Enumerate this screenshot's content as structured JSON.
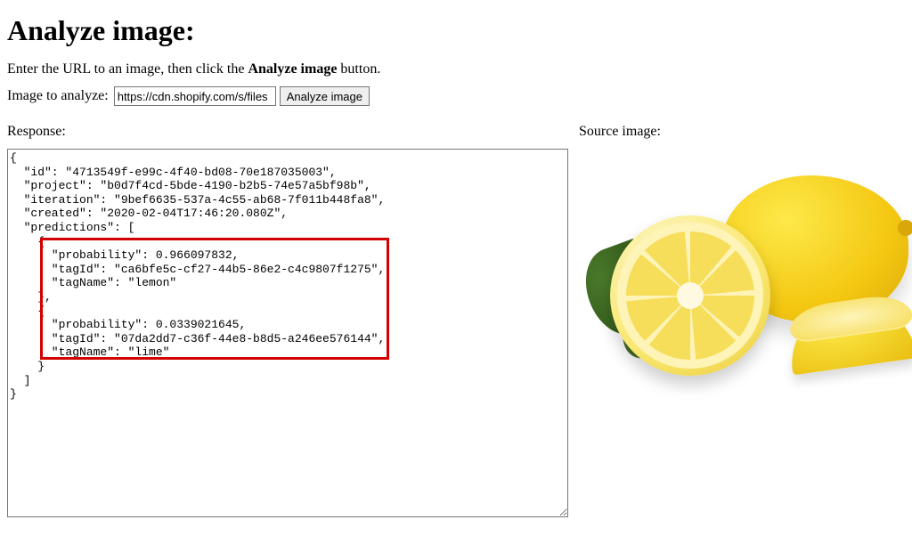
{
  "heading": "Analyze image:",
  "instruction_prefix": "Enter the URL to an image, then click the ",
  "instruction_bold": "Analyze image",
  "instruction_suffix": " button.",
  "form": {
    "label": "Image to analyze: ",
    "input_value": "https://cdn.shopify.com/s/files",
    "button_label": "Analyze image"
  },
  "response_label": "Response:",
  "source_label": "Source image:",
  "json_lines": {
    "l1": "{",
    "l2": "  \"id\": \"4713549f-e99c-4f40-bd08-70e187035003\",",
    "l3": "  \"project\": \"b0d7f4cd-5bde-4190-b2b5-74e57a5bf98b\",",
    "l4": "  \"iteration\": \"9bef6635-537a-4c55-ab68-7f011b448fa8\",",
    "l5": "  \"created\": \"2020-02-04T17:46:20.080Z\",",
    "l6": "  \"predictions\": [",
    "l7": "    {",
    "l8": "      \"probability\": 0.966097832,",
    "l9": "      \"tagId\": \"ca6bfe5c-cf27-44b5-86e2-c4c9807f1275\",",
    "l10": "      \"tagName\": \"lemon\"",
    "l11": "    },",
    "l12": "    {",
    "l13": "      \"probability\": 0.0339021645,",
    "l14": "      \"tagId\": \"07da2dd7-c36f-44e8-b8d5-a246ee576144\",",
    "l15": "      \"tagName\": \"lime\"",
    "l16": "    }",
    "l17": "  ]",
    "l18": "}"
  }
}
